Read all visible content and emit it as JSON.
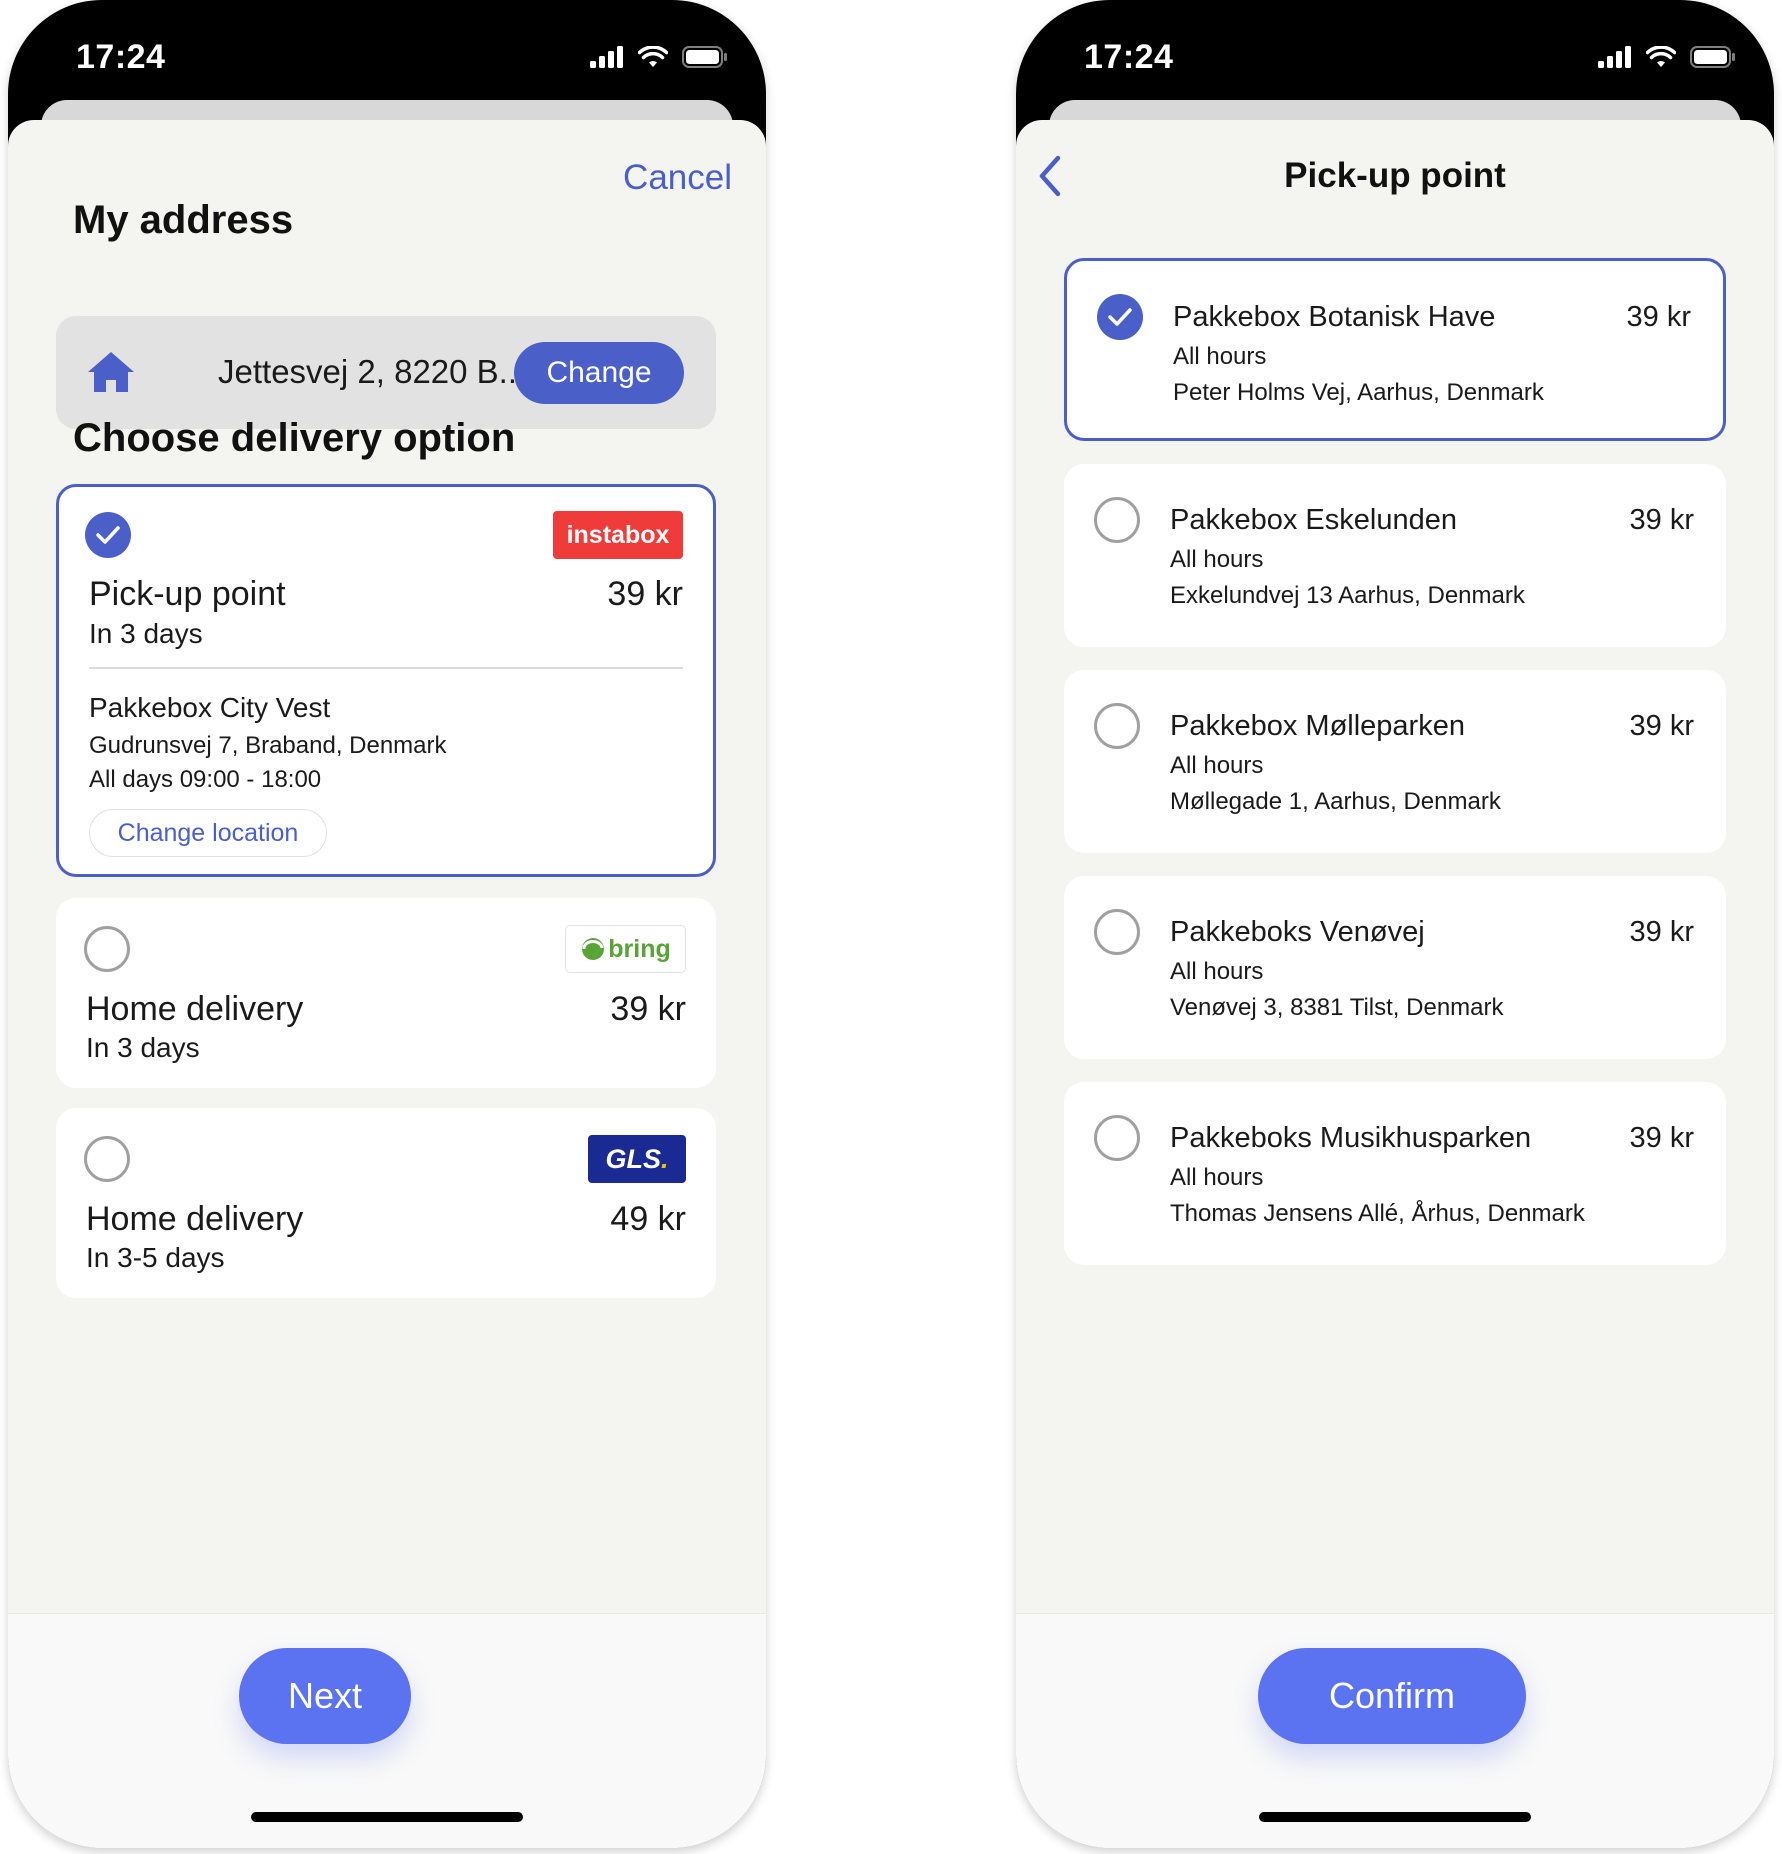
{
  "left_screen": {
    "status": {
      "time": "17:24"
    },
    "cancel_label": "Cancel",
    "address_heading": "My address",
    "address": {
      "text": "Jettesvej 2, 8220 B...",
      "change_label": "Change"
    },
    "delivery_heading": "Choose delivery option",
    "options": [
      {
        "carrier": "instabox",
        "title": "Pick-up point",
        "price": "39 kr",
        "eta": "In 3 days",
        "selected": true,
        "location": {
          "name": "Pakkebox City Vest",
          "address": "Gudrunsvej 7, Braband, Denmark",
          "hours": "All days 09:00 - 18:00",
          "change_label": "Change location"
        }
      },
      {
        "carrier": "bring",
        "title": "Home delivery",
        "price": "39 kr",
        "eta": "In 3 days",
        "selected": false
      },
      {
        "carrier": "GLS",
        "title": "Home delivery",
        "price": "49 kr",
        "eta": "In 3-5 days",
        "selected": false
      }
    ],
    "next_label": "Next"
  },
  "right_screen": {
    "status": {
      "time": "17:24"
    },
    "title": "Pick-up point",
    "points": [
      {
        "name": "Pakkebox Botanisk Have",
        "price": "39 kr",
        "hours": "All hours",
        "address": "Peter Holms Vej, Aarhus, Denmark",
        "selected": true
      },
      {
        "name": "Pakkebox Eskelunden",
        "price": "39 kr",
        "hours": "All hours",
        "address": "Exkelundvej 13 Aarhus, Denmark",
        "selected": false
      },
      {
        "name": "Pakkebox Mølleparken",
        "price": "39 kr",
        "hours": "All hours",
        "address": "Møllegade 1, Aarhus, Denmark",
        "selected": false
      },
      {
        "name": "Pakkeboks Venøvej",
        "price": "39 kr",
        "hours": "All hours",
        "address": "Venøvej 3, 8381 Tilst, Denmark",
        "selected": false
      },
      {
        "name": "Pakkeboks Musikhusparken",
        "price": "39 kr",
        "hours": "All hours",
        "address": "Thomas Jensens Allé, Århus, Denmark",
        "selected": false
      }
    ],
    "confirm_label": "Confirm"
  },
  "icons": {
    "status": [
      "signal-icon",
      "wifi-icon",
      "battery-icon"
    ],
    "address": "home-icon",
    "selection": [
      "checkmark-icon",
      "radio-empty-icon"
    ],
    "navigation": "back-arrow-icon"
  },
  "colors": {
    "accent": "#4b5fc8",
    "primary_button": "#5b73f0",
    "sheet_background": "#f4f4f1",
    "instabox_red": "#ef3b39",
    "bring_green": "#5aa437",
    "gls_blue": "#1a2a93",
    "gls_yellow": "#f5c200"
  }
}
